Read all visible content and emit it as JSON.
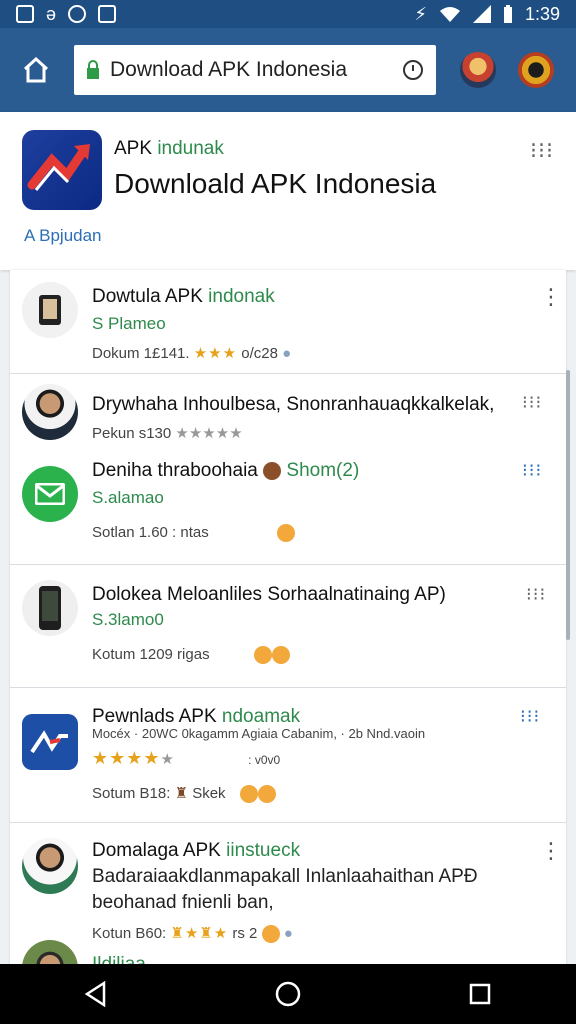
{
  "status_bar": {
    "time": "1:39"
  },
  "browser": {
    "url_text": "Download APK Indonesia"
  },
  "header": {
    "subtitle_plain": "APK",
    "subtitle_green": "indunak",
    "title": "Downloald APK Indonesia",
    "link_text": "A Bpjudan"
  },
  "rows": [
    {
      "title": "Dowtula APK ",
      "title_green": "indonak",
      "sub": "S Plameo",
      "meta": "Dokum 1£141.",
      "stars": "★★★",
      "meta_tail": "o/c28"
    },
    {
      "title": "Drywhaha Inhoulbesa, Snonranhauaqkkalkelak,",
      "meta": "Pekun s130",
      "stars": "★★★★★"
    },
    {
      "title": "Deniha thraboohaia",
      "title_tail": "Shom(2)",
      "sub": "S.alamao",
      "meta": "Sotlan 1.60 : ntas"
    },
    {
      "title": "Dolokea Meloanliles Sorhaalnatinaing AP)",
      "sub": "S.3lamo0",
      "meta": "Kotum 1209 rigas"
    },
    {
      "title": "Pewnlads APK ",
      "title_green": "ndoamak",
      "sub_line": "Mocéx · 20WC 0kagamm Agiaia Cabanim, · 2b Nnd.vaoin",
      "stars": "★★★★",
      "meta_tail": ": v0v0",
      "meta": "Sotum B18:",
      "meta_mid": "Skek"
    },
    {
      "title": "Domalaga APK ",
      "title_green": "iinstueck",
      "desc1": "Badaraiaakdlanmapakall Inlanlaahaithan APÐ",
      "desc2": "beohanad fnienli ban,",
      "meta": "Kotun B60:",
      "meta_tail": "rs 2"
    },
    {
      "title_green": "Ildiliaa"
    }
  ],
  "colors": {
    "app_bar": "#2a5b91",
    "status_bar": "#1f4f82",
    "accent_green": "#2d8a4c",
    "link_blue": "#2b6fb6",
    "star": "#e6a21b"
  }
}
